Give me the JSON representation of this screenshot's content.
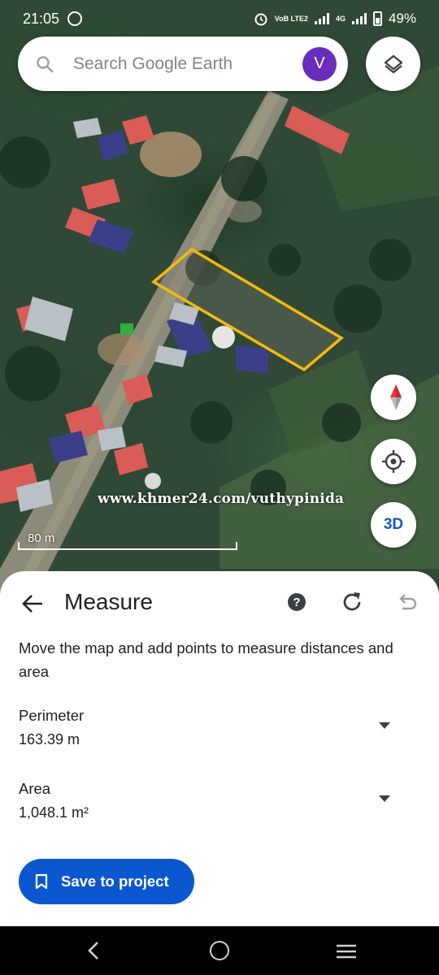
{
  "status_bar": {
    "time": "21:05",
    "volte_tag": "VoB LTE2",
    "network": "4G",
    "battery": "49%"
  },
  "search": {
    "placeholder": "Search Google Earth",
    "avatar_initial": "V"
  },
  "map": {
    "watermark": "www.khmer24.com/vuthypinida",
    "scale_label": "80 m",
    "measure_outline_color": "#f5b90d",
    "three_d_label": "3D"
  },
  "measure": {
    "title": "Measure",
    "help_label": "?",
    "description": "Move the map and add points to measure distances and area",
    "perimeter_label": "Perimeter",
    "perimeter_value": "163.39 m",
    "area_label": "Area",
    "area_value": "1,048.1 m²",
    "save_label": "Save to project"
  },
  "colors": {
    "accent": "#0b57d0",
    "avatar": "#6a2cbb",
    "text": "#202124"
  }
}
